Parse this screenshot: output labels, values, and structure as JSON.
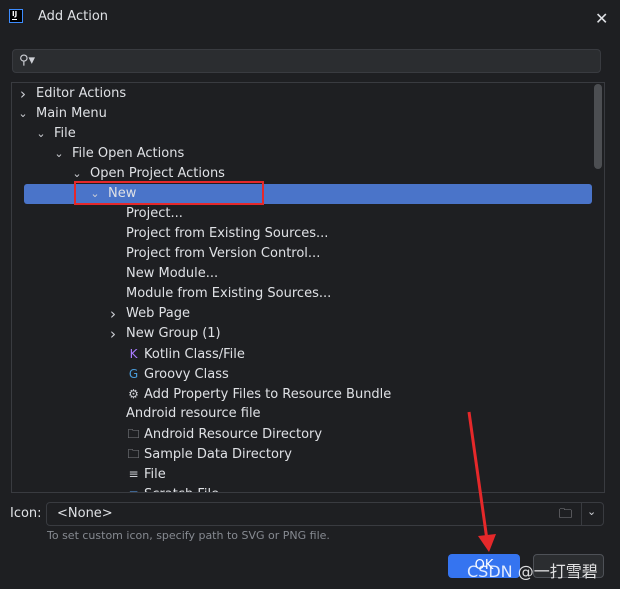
{
  "dialog": {
    "title": "Add Action",
    "close_icon": "close-icon"
  },
  "search": {
    "value": "",
    "placeholder": ""
  },
  "tree": [
    {
      "label": "Editor Actions",
      "level": 0,
      "state": "collapsed"
    },
    {
      "label": "Main Menu",
      "level": 0,
      "state": "expanded"
    },
    {
      "label": "File",
      "level": 1,
      "state": "expanded"
    },
    {
      "label": "File Open Actions",
      "level": 2,
      "state": "expanded"
    },
    {
      "label": "Open Project Actions",
      "level": 3,
      "state": "expanded"
    },
    {
      "label": "New",
      "level": 4,
      "state": "expanded",
      "selected": true
    },
    {
      "label": "Project...",
      "level": 5
    },
    {
      "label": "Project from Existing Sources...",
      "level": 5
    },
    {
      "label": "Project from Version Control...",
      "level": 5
    },
    {
      "label": "New Module...",
      "level": 5
    },
    {
      "label": "Module from Existing Sources...",
      "level": 5
    },
    {
      "label": "Web Page",
      "level": 5,
      "state": "collapsed"
    },
    {
      "label": "New Group (1)",
      "level": 5,
      "state": "collapsed"
    },
    {
      "label": "Kotlin Class/File",
      "level": 5,
      "icon": "kotlin-icon"
    },
    {
      "label": "Groovy Class",
      "level": 5,
      "icon": "groovy-icon"
    },
    {
      "label": "Add Property Files to Resource Bundle",
      "level": 5,
      "icon": "gear-icon"
    },
    {
      "label": "Android resource file",
      "level": 5
    },
    {
      "label": "Android Resource Directory",
      "level": 5,
      "icon": "folder-icon"
    },
    {
      "label": "Sample Data Directory",
      "level": 5,
      "icon": "folder-icon"
    },
    {
      "label": "File",
      "level": 5,
      "icon": "text-file-icon"
    },
    {
      "label": "Scratch File",
      "level": 5,
      "icon": "scratch-file-icon"
    }
  ],
  "icon_field": {
    "label": "Icon:",
    "value": "<None>",
    "hint": "To set custom icon, specify path to SVG or PNG file."
  },
  "buttons": {
    "ok": "OK"
  },
  "watermark": "CSDN @一打雪碧",
  "colors": {
    "selection": "#4a74c9",
    "accent": "#3574f0",
    "annotation": "#e5282a"
  }
}
